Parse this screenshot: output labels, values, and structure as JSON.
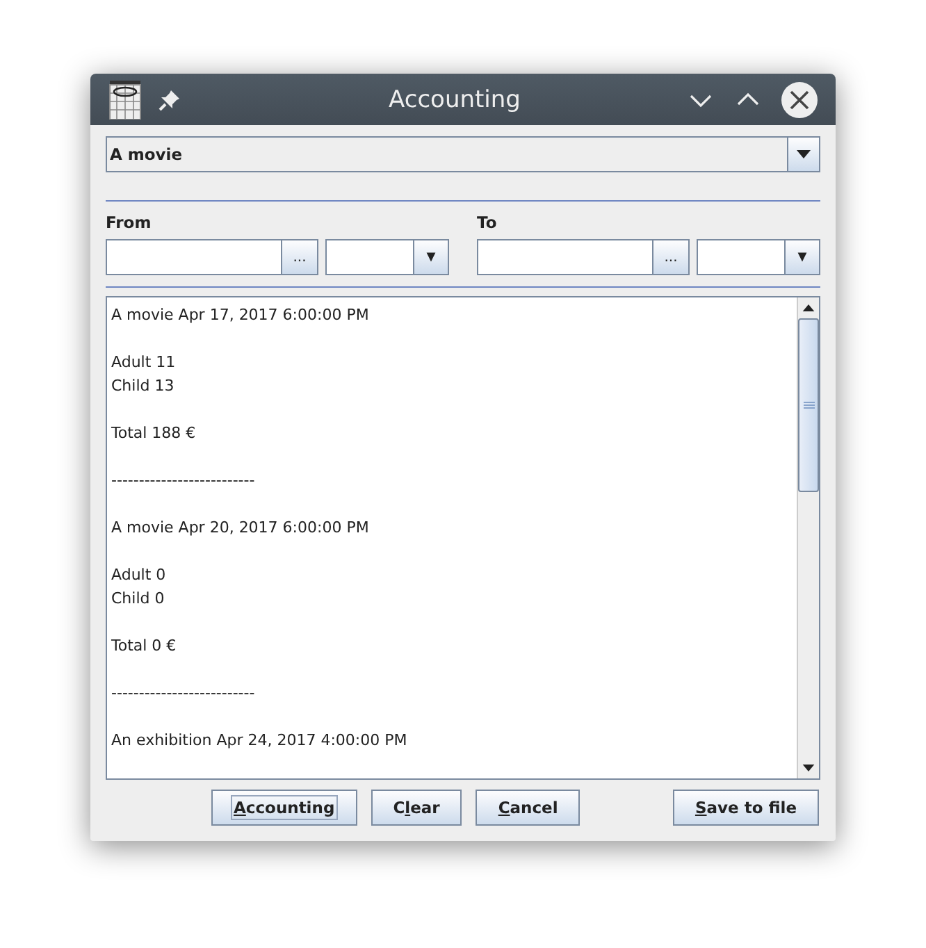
{
  "window": {
    "title": "Accounting"
  },
  "event_combo": {
    "value": "A movie"
  },
  "from": {
    "label": "From",
    "date_button": "..."
  },
  "to": {
    "label": "To",
    "date_button": "..."
  },
  "report": {
    "blocks": [
      [
        "A movie Apr 17, 2017 6:00:00 PM"
      ],
      [
        "Adult 11",
        "Child 13"
      ],
      [
        "Total 188 €"
      ],
      [
        "--------------------------"
      ],
      [
        "A movie Apr 20, 2017 6:00:00 PM"
      ],
      [
        "Adult 0",
        "Child 0"
      ],
      [
        "Total 0 €"
      ],
      [
        "--------------------------"
      ],
      [
        "An exhibition Apr 24, 2017 4:00:00 PM"
      ]
    ]
  },
  "buttons": [
    {
      "mnemonic": "A",
      "after": "ccounting",
      "focused": true,
      "kind": "main"
    },
    {
      "before": "C",
      "mnemonic": "l",
      "after": "ear",
      "focused": false,
      "kind": "main"
    },
    {
      "mnemonic": "C",
      "after": "ancel",
      "focused": false,
      "kind": "main"
    },
    {
      "mnemonic": "S",
      "after": "ave to file",
      "focused": false,
      "kind": "right"
    }
  ]
}
